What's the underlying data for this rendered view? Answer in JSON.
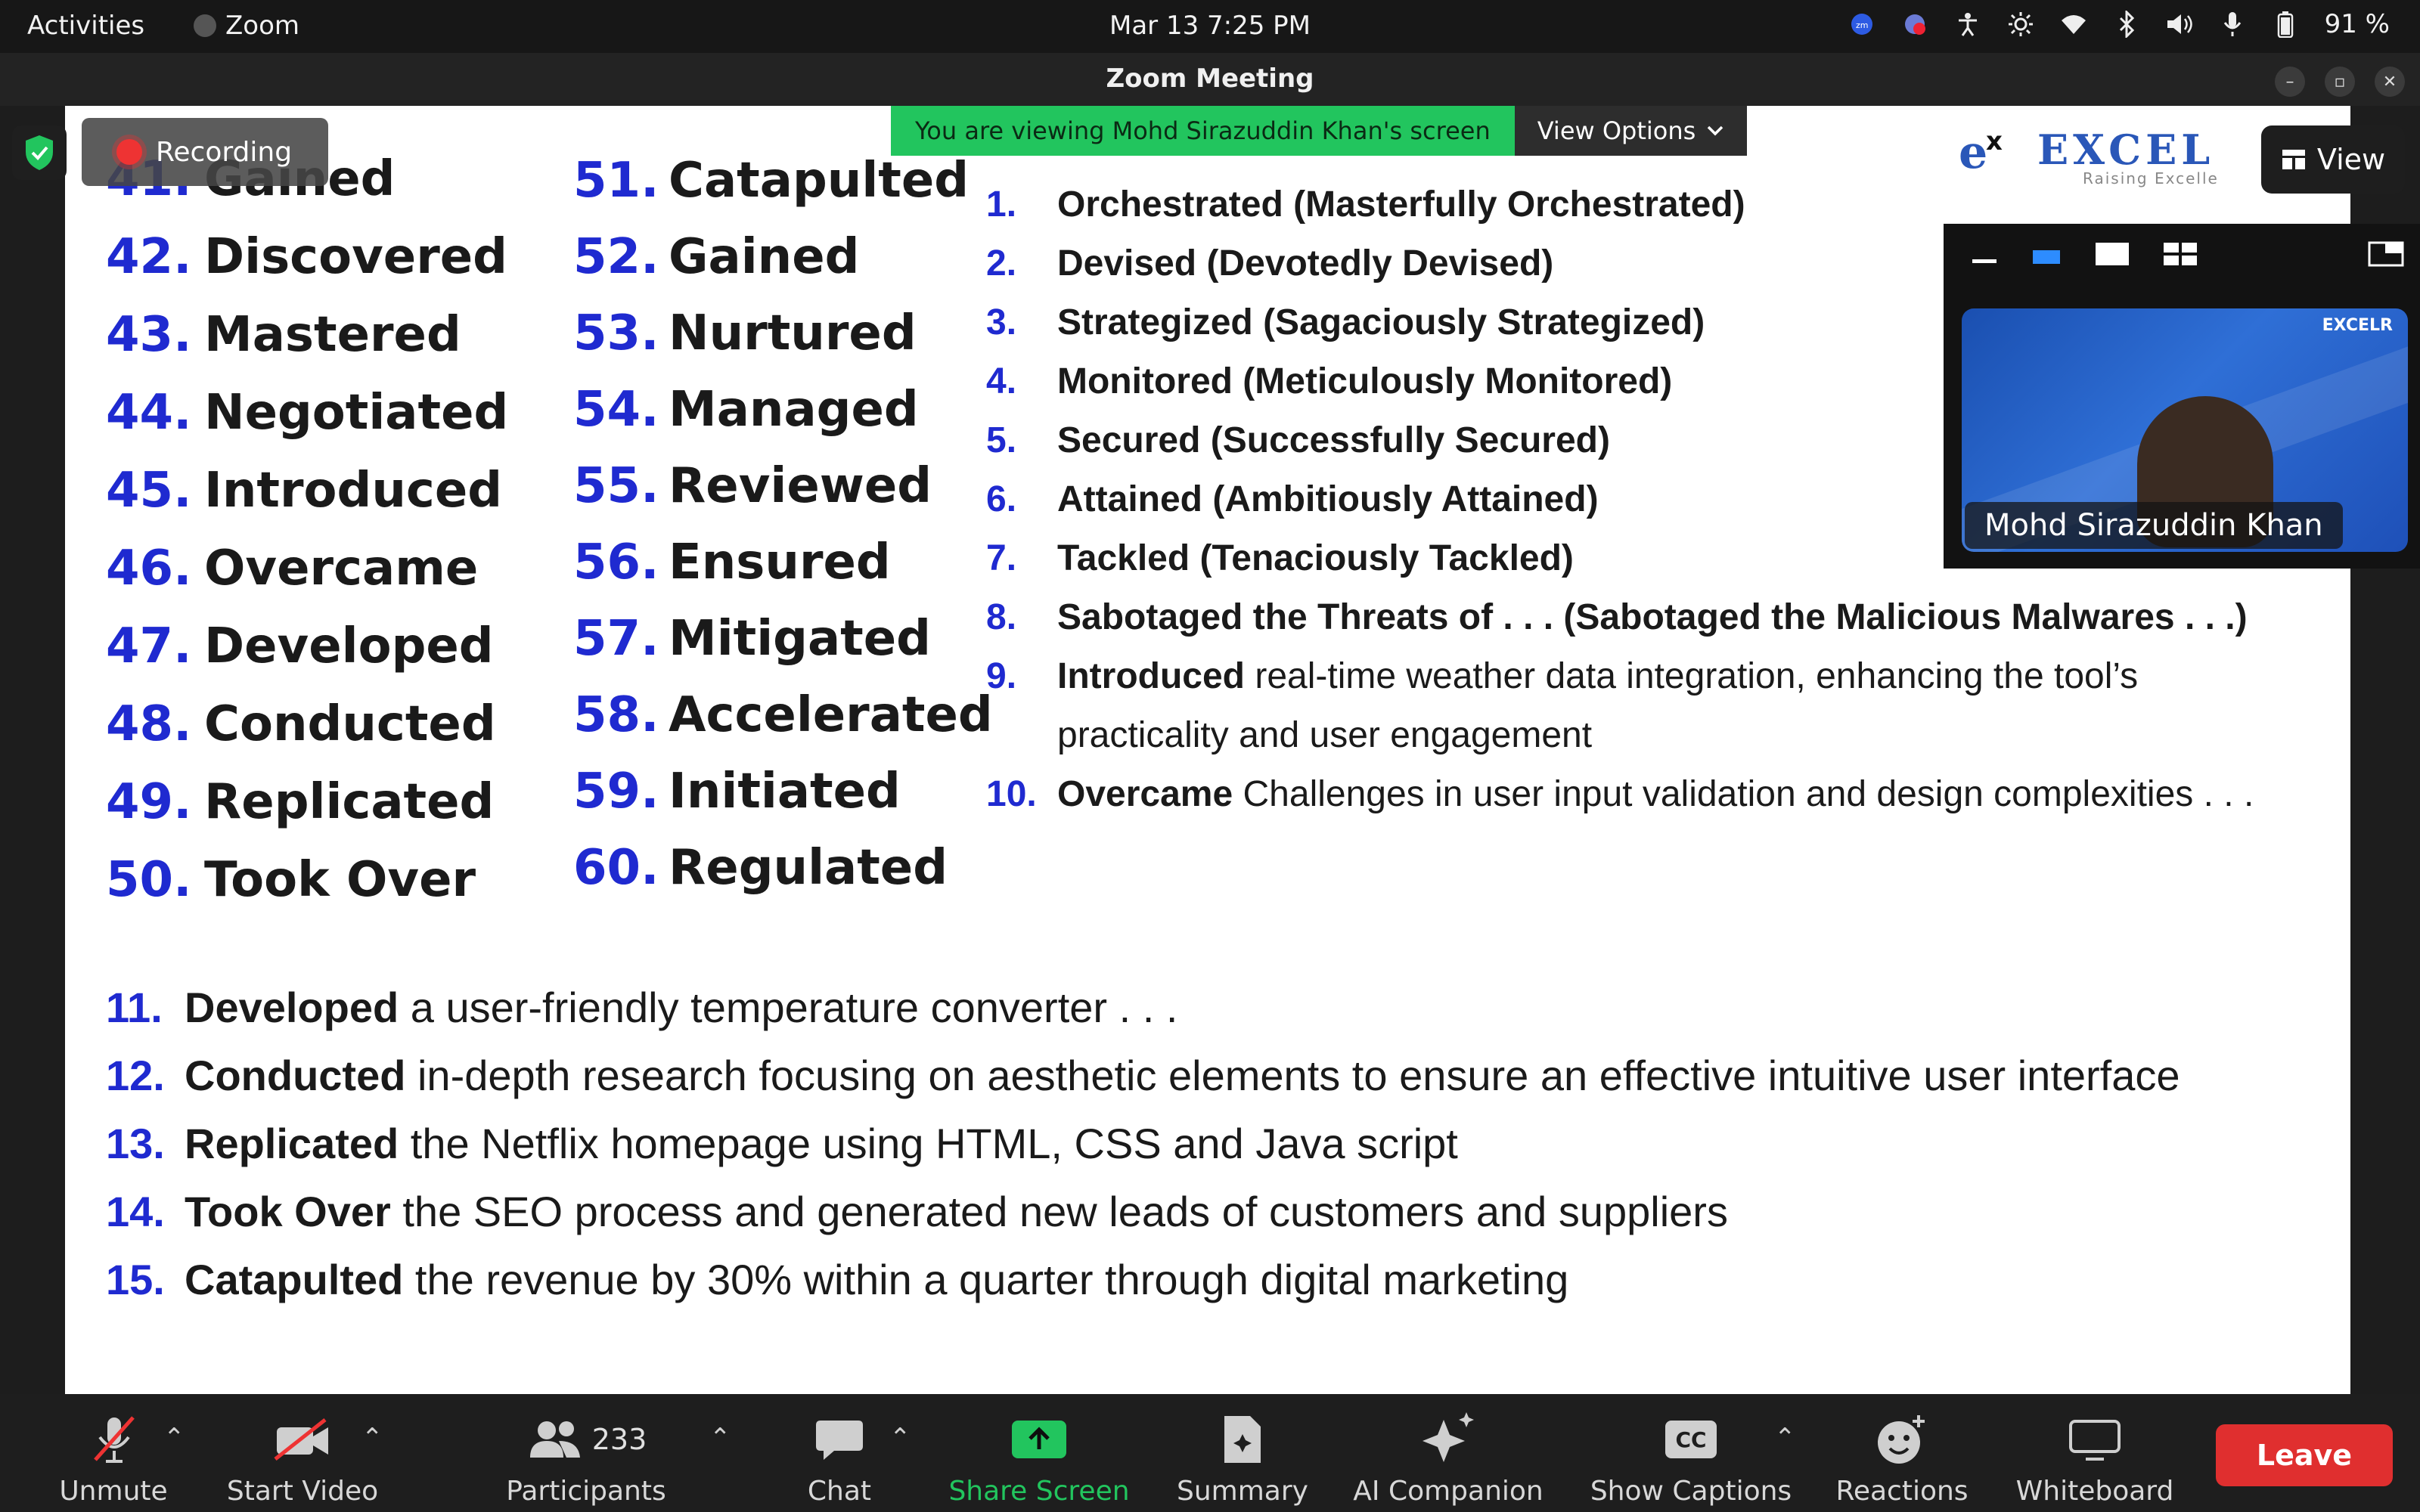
{
  "system_bar": {
    "activities": "Activities",
    "app_name": "Zoom",
    "datetime": "Mar 13   7:25 PM",
    "battery": "91 %"
  },
  "window": {
    "title": "Zoom Meeting"
  },
  "share_banner": {
    "message": "You are viewing Mohd Sirazuddin Khan's screen",
    "view_options": "View Options"
  },
  "recording": {
    "label": "Recording"
  },
  "view_button": {
    "label": "View"
  },
  "participant_tile": {
    "name": "Mohd Sirazuddin Khan",
    "logo_text": "EXCEL",
    "logo_sub": "Raising Excelle",
    "mini_logo": "EXCELR"
  },
  "slide": {
    "col1": [
      {
        "num": "41.",
        "word": "Gained"
      },
      {
        "num": "42.",
        "word": "Discovered"
      },
      {
        "num": "43.",
        "word": "Mastered"
      },
      {
        "num": "44.",
        "word": "Negotiated"
      },
      {
        "num": "45.",
        "word": "Introduced"
      },
      {
        "num": "46.",
        "word": "Overcame"
      },
      {
        "num": "47.",
        "word": "Developed"
      },
      {
        "num": "48.",
        "word": "Conducted"
      },
      {
        "num": "49.",
        "word": "Replicated"
      },
      {
        "num": "50.",
        "word": "Took Over"
      }
    ],
    "col2": [
      {
        "num": "51.",
        "word": "Catapulted"
      },
      {
        "num": "52.",
        "word": "Gained"
      },
      {
        "num": "53.",
        "word": "Nurtured"
      },
      {
        "num": "54.",
        "word": "Managed"
      },
      {
        "num": "55.",
        "word": "Reviewed"
      },
      {
        "num": "56.",
        "word": "Ensured"
      },
      {
        "num": "57.",
        "word": "Mitigated"
      },
      {
        "num": "58.",
        "word": "Accelerated"
      },
      {
        "num": "59.",
        "word": "Initiated"
      },
      {
        "num": "60.",
        "word": "Regulated"
      }
    ],
    "right": [
      {
        "num": "1.",
        "bold": "Orchestrated (Masterfully Orchestrated)",
        "rest": ""
      },
      {
        "num": "2.",
        "bold": "Devised (Devotedly Devised)",
        "rest": ""
      },
      {
        "num": "3.",
        "bold": "Strategized (Sagaciously Strategized)",
        "rest": ""
      },
      {
        "num": "4.",
        "bold": "Monitored (Meticulously Monitored)",
        "rest": ""
      },
      {
        "num": "5.",
        "bold": "Secured (Successfully Secured)",
        "rest": ""
      },
      {
        "num": "6.",
        "bold": "Attained (Ambitiously Attained)",
        "rest": ""
      },
      {
        "num": "7.",
        "bold": "Tackled (Tenaciously Tackled)",
        "rest": ""
      },
      {
        "num": "8.",
        "bold": "Sabotaged the Threats of . . . (Sabotaged the Malicious Malwares . . .)",
        "rest": ""
      },
      {
        "num": "9.",
        "bold": "Introduced",
        "rest": " real-time weather data integration, enhancing the tool’s"
      },
      {
        "num": "",
        "bold": "",
        "rest": "practicality and user engagement"
      },
      {
        "num": "10.",
        "bold": "Overcame",
        "rest": " Challenges in user input validation and design complexities . . ."
      }
    ],
    "bottom": [
      {
        "num": "11.",
        "bold": "Developed",
        "rest": " a user-friendly temperature converter . . ."
      },
      {
        "num": "12.",
        "bold": "Conducted",
        "rest": " in-depth research focusing on aesthetic elements to ensure an effective intuitive user interface"
      },
      {
        "num": "13.",
        "bold": "Replicated",
        "rest": " the Netflix homepage using HTML, CSS and Java script"
      },
      {
        "num": "14.",
        "bold": "Took Over",
        "rest": " the SEO process and generated new leads of customers and suppliers"
      },
      {
        "num": "15.",
        "bold": "Catapulted",
        "rest": " the revenue by 30% within a quarter through digital marketing"
      }
    ]
  },
  "toolbar": {
    "unmute": "Unmute",
    "start_video": "Start Video",
    "participants": "Participants",
    "participants_count": "233",
    "chat": "Chat",
    "share_screen": "Share Screen",
    "summary": "Summary",
    "ai_companion": "AI Companion",
    "show_captions": "Show Captions",
    "captions_icon_text": "CC",
    "reactions": "Reactions",
    "whiteboard": "Whiteboard",
    "leave": "Leave"
  },
  "colors": {
    "share_green": "#22c55e",
    "leave_red": "#e02f2f",
    "slide_number_blue": "#1f2ad0"
  }
}
